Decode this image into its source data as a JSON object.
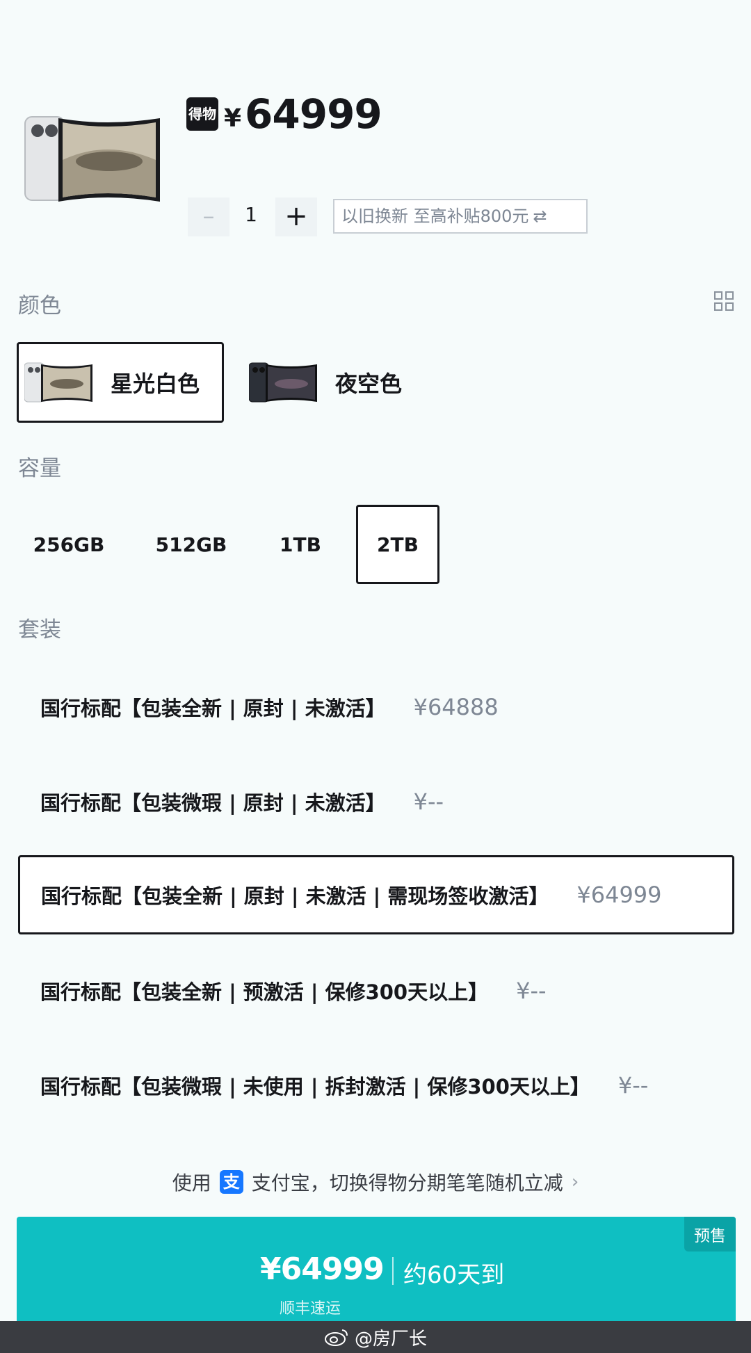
{
  "header": {
    "brand_badge": "得物",
    "currency_symbol": "¥",
    "price": "64999",
    "quantity": "1",
    "qty_minus_icon": "minus-icon",
    "qty_plus_icon": "plus-icon",
    "tradein_text": "以旧换新 至高补贴800元",
    "tradein_icon": "swap-arrows-icon"
  },
  "color_section": {
    "label": "颜色",
    "layout_toggle_icon": "grid-icon",
    "options": [
      {
        "name": "星光白色",
        "selected": true
      },
      {
        "name": "夜空色",
        "selected": false
      }
    ]
  },
  "capacity_section": {
    "label": "容量",
    "options": [
      {
        "name": "256GB",
        "selected": false
      },
      {
        "name": "512GB",
        "selected": false
      },
      {
        "name": "1TB",
        "selected": false
      },
      {
        "name": "2TB",
        "selected": true
      }
    ]
  },
  "bundle_section": {
    "label": "套装",
    "options": [
      {
        "name": "国行标配【包装全新 | 原封 | 未激活】",
        "price": "¥64888",
        "selected": false
      },
      {
        "name": "国行标配【包装微瑕 | 原封 | 未激活】",
        "price": "¥--",
        "selected": false
      },
      {
        "name": "国行标配【包装全新 | 原封 | 未激活 | 需现场签收激活】",
        "price": "¥64999",
        "selected": true
      },
      {
        "name": "国行标配【包装全新 | 预激活 | 保修300天以上】",
        "price": "¥--",
        "selected": false
      },
      {
        "name": "国行标配【包装微瑕 | 未使用 | 拆封激活 | 保修300天以上】",
        "price": "¥--",
        "selected": false
      }
    ]
  },
  "promo": {
    "prefix": "使用",
    "alipay_glyph": "支",
    "text": "支付宝，切换得物分期笔笔随机立减",
    "chevron": "›"
  },
  "buy": {
    "tag": "预售",
    "price": "¥64999",
    "eta": "约60天到",
    "shipping": "顺丰速运",
    "color": "#0fbfc2"
  },
  "watermark": {
    "text": "@房厂长"
  }
}
